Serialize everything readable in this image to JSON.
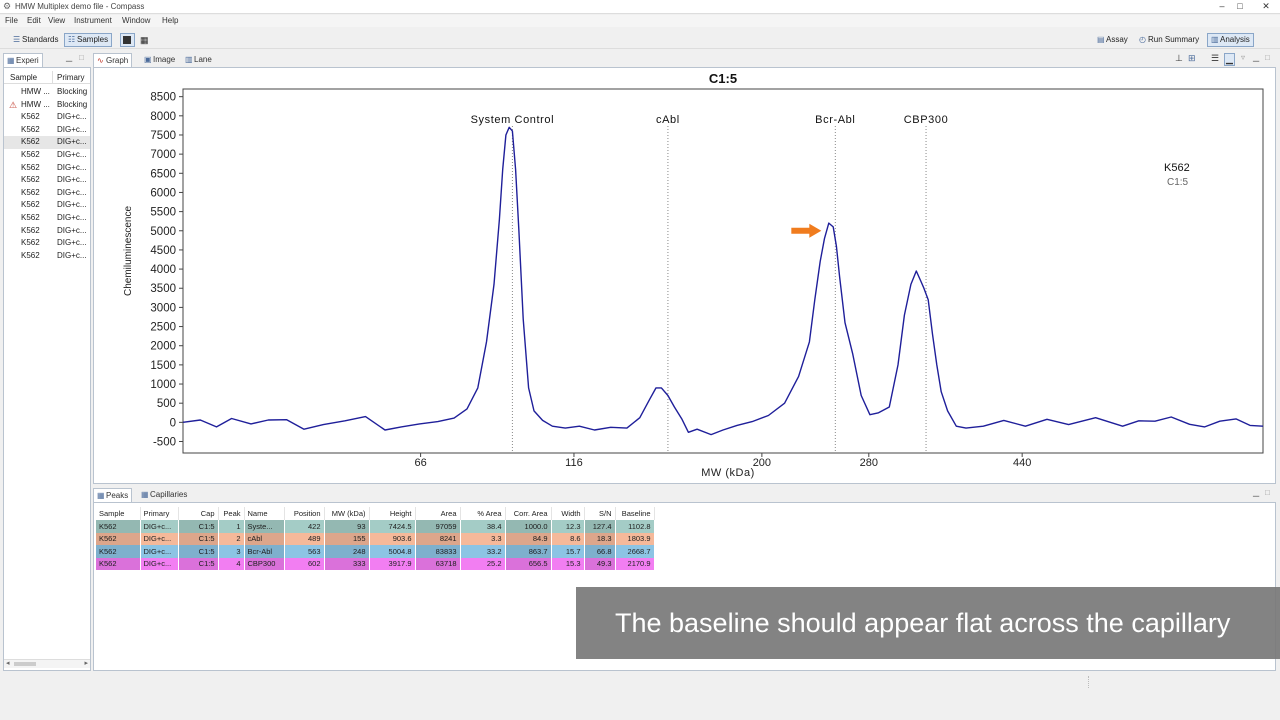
{
  "window": {
    "title": "HMW Multiplex demo file - Compass"
  },
  "menu": [
    "File",
    "Edit",
    "View",
    "Instrument",
    "Window",
    "Help"
  ],
  "toolbar": {
    "standards": "Standards",
    "samples": "Samples",
    "assay": "Assay",
    "run_summary": "Run Summary",
    "analysis": "Analysis"
  },
  "left": {
    "tab": "Experi",
    "headers": [
      "Sample",
      "Primary"
    ],
    "rows": [
      [
        "HMW ...",
        "Blocking"
      ],
      [
        "HMW ...",
        "Blocking"
      ],
      [
        "K562",
        "DIG+c..."
      ],
      [
        "K562",
        "DIG+c..."
      ],
      [
        "K562",
        "DIG+c..."
      ],
      [
        "K562",
        "DIG+c..."
      ],
      [
        "K562",
        "DIG+c..."
      ],
      [
        "K562",
        "DIG+c..."
      ],
      [
        "K562",
        "DIG+c..."
      ],
      [
        "K562",
        "DIG+c..."
      ],
      [
        "K562",
        "DIG+c..."
      ],
      [
        "K562",
        "DIG+c..."
      ],
      [
        "K562",
        "DIG+c..."
      ],
      [
        "K562",
        "DIG+c..."
      ]
    ]
  },
  "graph_tabs": [
    "Graph",
    "Image",
    "Lane"
  ],
  "bottom_tabs": [
    "Peaks",
    "Capillaries"
  ],
  "chart_data": {
    "type": "line",
    "title": "C1:5",
    "xlabel": "MW (kDa)",
    "ylabel": "Chemiluminescence",
    "yticks": [
      8500,
      8000,
      7500,
      7000,
      6500,
      6000,
      5500,
      5000,
      4500,
      4000,
      3500,
      3000,
      2500,
      2000,
      1500,
      1000,
      500,
      0,
      -500
    ],
    "ylim": [
      -800,
      8700
    ],
    "xticks": [
      "66",
      "116",
      "200",
      "280",
      "440"
    ],
    "xlim": [
      0,
      1000
    ],
    "xtick_positions": [
      220,
      362,
      536,
      635,
      777
    ],
    "legend": [
      "K562",
      "C1:5"
    ],
    "peak_labels": [
      {
        "label": "System Control",
        "x": 305
      },
      {
        "label": "cAbl",
        "x": 449
      },
      {
        "label": "Bcr-Abl",
        "x": 604
      },
      {
        "label": "CBP300",
        "x": 688
      }
    ],
    "line_color": "#1f1f9a",
    "arrow_color": "#f07c1e",
    "arrow_at": {
      "x": 604,
      "y": 5000
    },
    "series": [
      {
        "x": [
          0,
          16,
          31,
          45,
          63,
          79,
          96,
          112,
          130,
          150,
          169,
          187,
          202,
          219,
          236,
          251,
          263,
          273,
          281,
          288,
          293,
          296,
          299,
          302,
          305,
          308,
          311,
          315,
          320,
          325,
          333,
          342,
          354,
          367,
          381,
          396,
          411,
          423,
          432,
          438,
          443,
          449,
          455,
          462,
          468,
          476,
          489,
          500,
          513,
          527,
          542,
          557,
          570,
          580,
          585,
          590,
          594,
          598,
          602,
          605,
          608,
          613,
          620,
          628,
          636,
          644,
          654,
          662,
          668,
          674,
          679,
          683,
          686,
          690,
          694,
          698,
          702,
          708,
          716,
          725,
          741,
          760,
          780,
          800,
          820,
          845,
          870,
          885,
          900,
          915,
          932,
          946,
          960,
          975,
          988,
          1000
        ],
        "y": [
          0,
          60,
          -120,
          100,
          -40,
          60,
          70,
          -180,
          -60,
          40,
          150,
          -200,
          -120,
          -40,
          20,
          110,
          350,
          900,
          2100,
          3600,
          5300,
          6600,
          7500,
          7700,
          7600,
          6600,
          5000,
          2700,
          900,
          300,
          50,
          -100,
          -150,
          -100,
          -200,
          -130,
          -150,
          120,
          600,
          900,
          900,
          700,
          400,
          80,
          -260,
          -180,
          -320,
          -200,
          -80,
          20,
          180,
          500,
          1200,
          2100,
          3200,
          4200,
          4800,
          5200,
          5100,
          4600,
          3800,
          2600,
          1800,
          700,
          200,
          250,
          400,
          1500,
          2800,
          3600,
          3950,
          3700,
          3500,
          3200,
          2300,
          1500,
          800,
          300,
          -100,
          -150,
          -100,
          50,
          -100,
          80,
          -60,
          120,
          -100,
          40,
          30,
          140,
          -50,
          -120,
          30,
          90,
          -80,
          -100
        ]
      }
    ]
  },
  "peaks_table": {
    "headers": [
      "Sample",
      "Primary",
      "Cap",
      "Peak",
      "Name",
      "Position",
      "MW (kDa)",
      "Height",
      "Area",
      "% Area",
      "Corr. Area",
      "Width",
      "S/N",
      "Baseline"
    ],
    "rows": [
      {
        "color": "#a4ccc6",
        "cells": [
          "K562",
          "DIG+c...",
          "C1:5",
          "1",
          "Syste...",
          "422",
          "93",
          "7424.5",
          "97059",
          "38.4",
          "1000.0",
          "12.3",
          "127.4",
          "1102.8"
        ]
      },
      {
        "color": "#f5b99a",
        "cells": [
          "K562",
          "DIG+c...",
          "C1:5",
          "2",
          "cAbl",
          "489",
          "155",
          "903.6",
          "8241",
          "3.3",
          "84.9",
          "8.6",
          "18.3",
          "1803.9"
        ]
      },
      {
        "color": "#8cc4e4",
        "cells": [
          "K562",
          "DIG+c...",
          "C1:5",
          "3",
          "Bcr-Abl",
          "563",
          "248",
          "5004.8",
          "83833",
          "33.2",
          "863.7",
          "15.7",
          "66.8",
          "2668.7"
        ]
      },
      {
        "color": "#f27ef2",
        "cells": [
          "K562",
          "DIG+c...",
          "C1:5",
          "4",
          "CBP300",
          "602",
          "333",
          "3917.9",
          "63718",
          "25.2",
          "656.5",
          "15.3",
          "49.3",
          "2170.9"
        ]
      }
    ]
  },
  "caption": "The baseline should appear flat across the capillary"
}
